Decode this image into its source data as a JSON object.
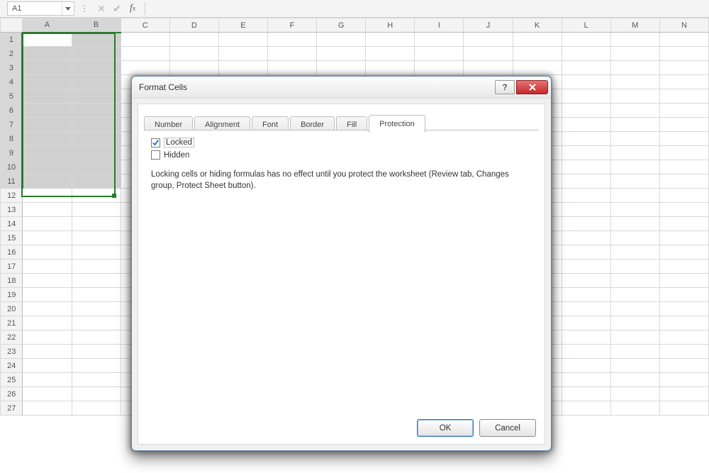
{
  "formula_bar": {
    "name_box_value": "A1"
  },
  "grid": {
    "columns": [
      "A",
      "B",
      "C",
      "D",
      "E",
      "F",
      "G",
      "H",
      "I",
      "J",
      "K",
      "L",
      "M",
      "N"
    ],
    "visible_rows": 27,
    "selected_cols": [
      "A",
      "B"
    ],
    "selected_rows": [
      1,
      2,
      3,
      4,
      5,
      6,
      7,
      8,
      9,
      10,
      11
    ],
    "active_cell": "A1"
  },
  "dialog": {
    "title": "Format Cells",
    "tabs": [
      {
        "label": "Number"
      },
      {
        "label": "Alignment"
      },
      {
        "label": "Font"
      },
      {
        "label": "Border"
      },
      {
        "label": "Fill"
      },
      {
        "label": "Protection"
      }
    ],
    "active_tab": "Protection",
    "protection": {
      "locked_label": "Locked",
      "locked_checked": true,
      "hidden_label": "Hidden",
      "hidden_checked": false,
      "info_text": "Locking cells or hiding formulas has no effect until you protect the worksheet (Review tab, Changes group, Protect Sheet button)."
    },
    "buttons": {
      "ok": "OK",
      "cancel": "Cancel"
    }
  }
}
